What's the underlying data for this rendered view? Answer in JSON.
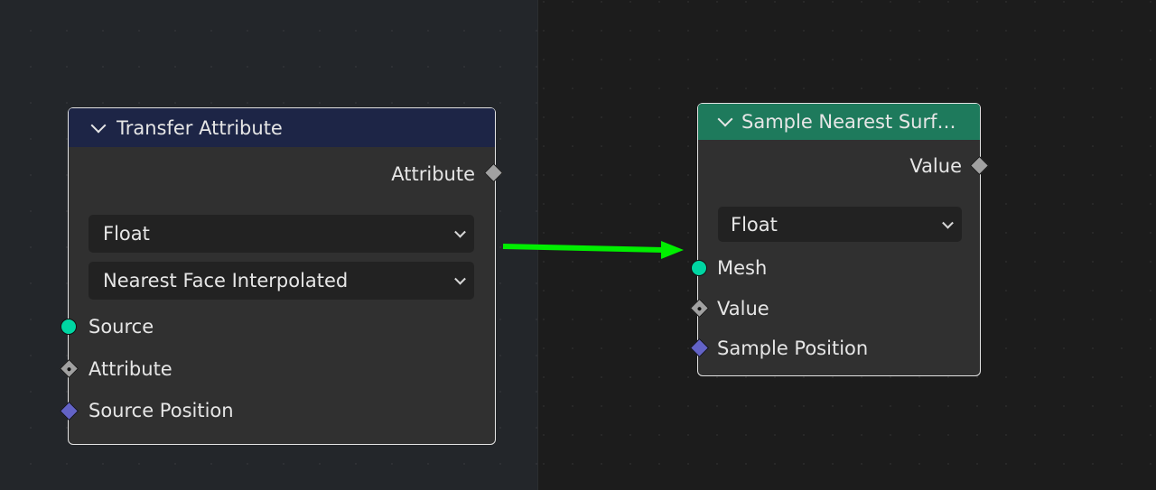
{
  "node_transfer": {
    "title": "Transfer Attribute",
    "header_color": "#1d2546",
    "output_attribute": "Attribute",
    "data_type": "Float",
    "mapping": "Nearest Face Interpolated",
    "input_source": "Source",
    "input_attribute": "Attribute",
    "input_source_position": "Source Position"
  },
  "node_sample": {
    "title": "Sample Nearest Surf…",
    "header_color": "#1e7a5c",
    "output_value": "Value",
    "data_type": "Float",
    "input_mesh": "Mesh",
    "input_value": "Value",
    "input_sample_position": "Sample Position"
  },
  "socket_colors": {
    "geometry": "#00d6a3",
    "float": "#a1a1a1",
    "vector": "#6363c7"
  },
  "arrow_color": "#00ee00"
}
